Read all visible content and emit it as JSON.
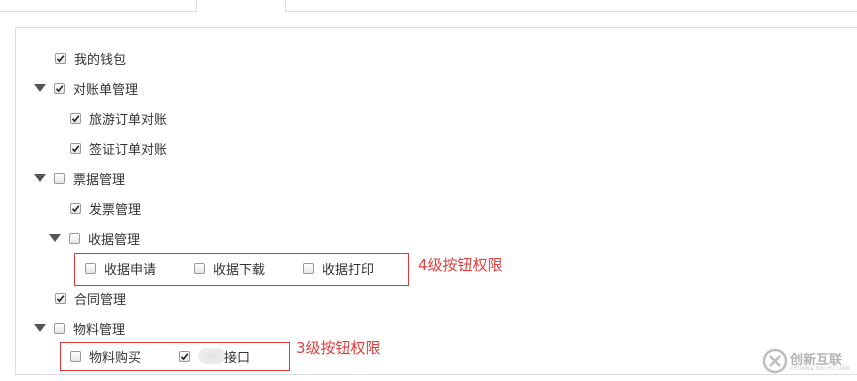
{
  "tree": {
    "my_wallet": {
      "label": "我的钱包",
      "checked": true
    },
    "reconciliation": {
      "label": "对账单管理",
      "checked": true,
      "expanded": true
    },
    "tour_order": {
      "label": "旅游订单对账",
      "checked": true
    },
    "visa_order": {
      "label": "签证订单对账",
      "checked": true
    },
    "receipt_mgmt": {
      "label": "票据管理",
      "checked": false,
      "expanded": true
    },
    "invoice_mgmt": {
      "label": "发票管理",
      "checked": true
    },
    "collection_mgmt": {
      "label": "收据管理",
      "checked": false,
      "expanded": true
    },
    "collection_apply": {
      "label": "收据申请",
      "checked": false
    },
    "collection_download": {
      "label": "收据下载",
      "checked": false
    },
    "collection_print": {
      "label": "收据打印",
      "checked": false
    },
    "contract_mgmt": {
      "label": "合同管理",
      "checked": true
    },
    "material_mgmt": {
      "label": "物料管理",
      "checked": false,
      "expanded": true
    },
    "material_purchase": {
      "label": "物料购买",
      "checked": false
    },
    "material_interface": {
      "label": "接口",
      "checked": true
    }
  },
  "annotations": {
    "level4": "4级按钮权限",
    "level3": "3级按钮权限",
    "color": "#e0403f"
  },
  "watermark": {
    "text": "创新互联",
    "subtext": "CHUANG XIN HU LIAN"
  }
}
